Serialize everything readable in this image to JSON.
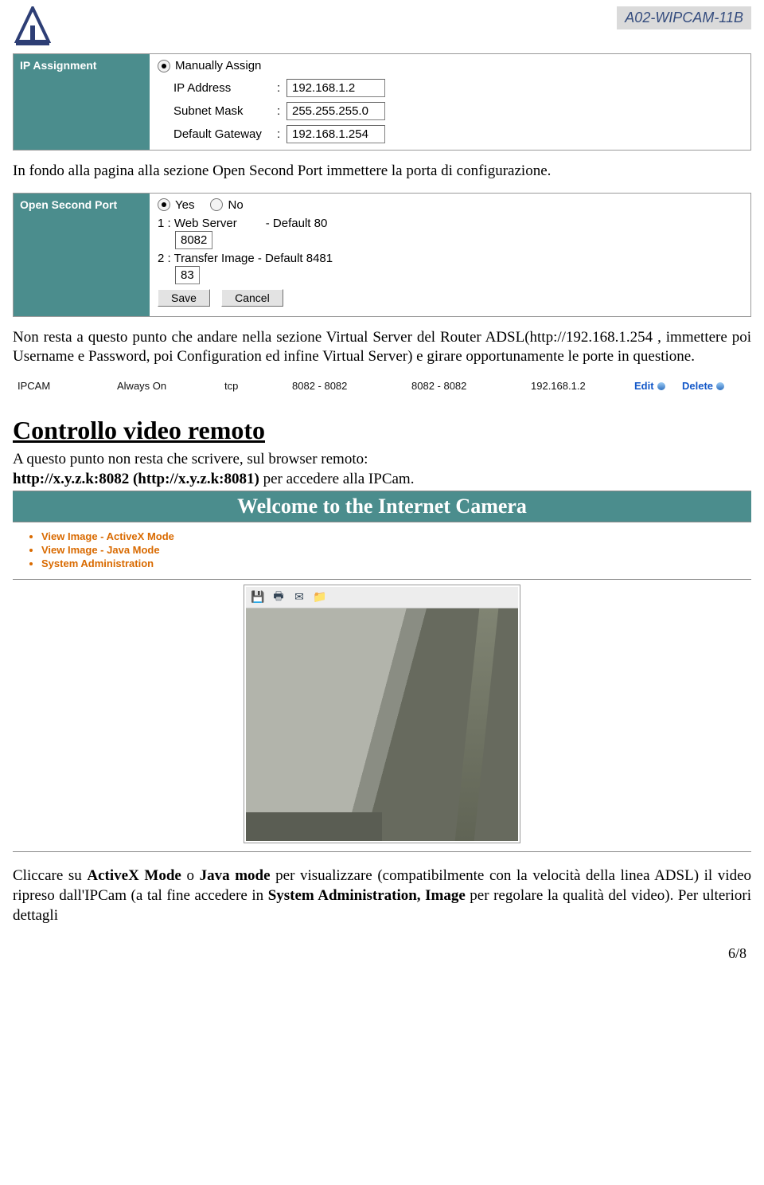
{
  "header": {
    "model": "A02-WIPCAM-11B"
  },
  "ip_panel": {
    "title": "IP Assignment",
    "mode_label": "Manually Assign",
    "fields": {
      "ip_label": "IP Address",
      "ip_value": "192.168.1.2",
      "mask_label": "Subnet Mask",
      "mask_value": "255.255.255.0",
      "gw_label": "Default Gateway",
      "gw_value": "192.168.1.254"
    }
  },
  "para1": "In fondo alla pagina alla sezione Open Second Port immettere la porta di configurazione.",
  "osp": {
    "title": "Open Second Port",
    "yes": "Yes",
    "no": "No",
    "line1a": "1 : Web Server",
    "line1b": "- Default 80",
    "val1": "8082",
    "line2a": "2 : Transfer Image - Default 8481",
    "val2": "83",
    "save": "Save",
    "cancel": "Cancel"
  },
  "para2": "Non resta a questo punto che andare nella sezione Virtual Server del Router ADSL(http://192.168.1.254 , immettere poi Username e Password, poi Configuration ed infine Virtual Server) e girare opportunamente le porte in questione.",
  "vs": {
    "name": "IPCAM",
    "sched": "Always On",
    "proto": "tcp",
    "ext": "8082 - 8082",
    "int": "8082 - 8082",
    "ip": "192.168.1.2",
    "edit": "Edit",
    "del": "Delete"
  },
  "heading": "Controllo video remoto",
  "para3a": "A questo punto non resta che scrivere, sul browser remoto:",
  "para3b_pre": "http://x.y.z.k:8082 (http://x.y.z.k:8081)",
  "para3b_post": " per accedere alla IPCam.",
  "welcome": "Welcome to the Internet Camera",
  "links": {
    "l1": "View Image - ActiveX Mode",
    "l2": "View Image - Java Mode",
    "l3": "System Administration"
  },
  "para4a": "Cliccare su ",
  "para4b": "ActiveX Mode",
  "para4c": " o ",
  "para4d": "Java mode",
  "para4e": " per visualizzare (compatibilmente con la velocità della linea ADSL) il video ripreso dall'IPCam (a tal fine accedere in ",
  "para4f": "System Administration, Image",
  "para4g": " per regolare la qualità del video). Per ulteriori dettagli",
  "footer": "6/8"
}
